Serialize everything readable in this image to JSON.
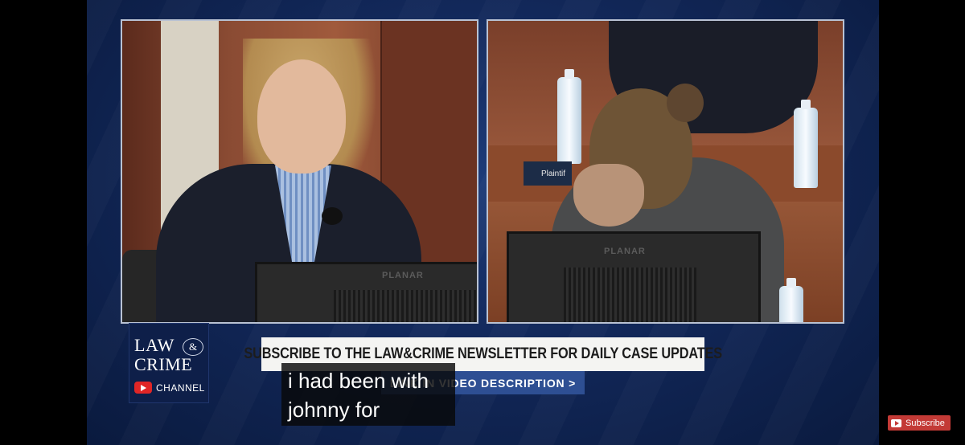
{
  "logo": {
    "line1": "LAW",
    "ampersand": "&",
    "line2": "CRIME",
    "channel": "CHANNEL",
    "youtube_icon": "youtube-play-icon"
  },
  "feeds": {
    "left": {
      "monitor_brand": "PLANAR"
    },
    "right": {
      "monitor_brand": "PLANAR",
      "binder_label": "Plaintif"
    }
  },
  "banner": {
    "text": "SUBSCRIBE TO THE LAW&CRIME NEWSLETTER FOR DAILY CASE UPDATES",
    "link_text": "LINK IN VIDEO DESCRIPTION >"
  },
  "captions": {
    "line1": "i had been with",
    "line2": "johnny for"
  },
  "subscribe_button": {
    "label": "Subscribe",
    "icon": "youtube-play-icon"
  },
  "colors": {
    "background": "#12285a",
    "banner_bg": "#f4f4f2",
    "link_bar_bg": "#2e4f93",
    "subscribe_bg": "#c33a36"
  }
}
